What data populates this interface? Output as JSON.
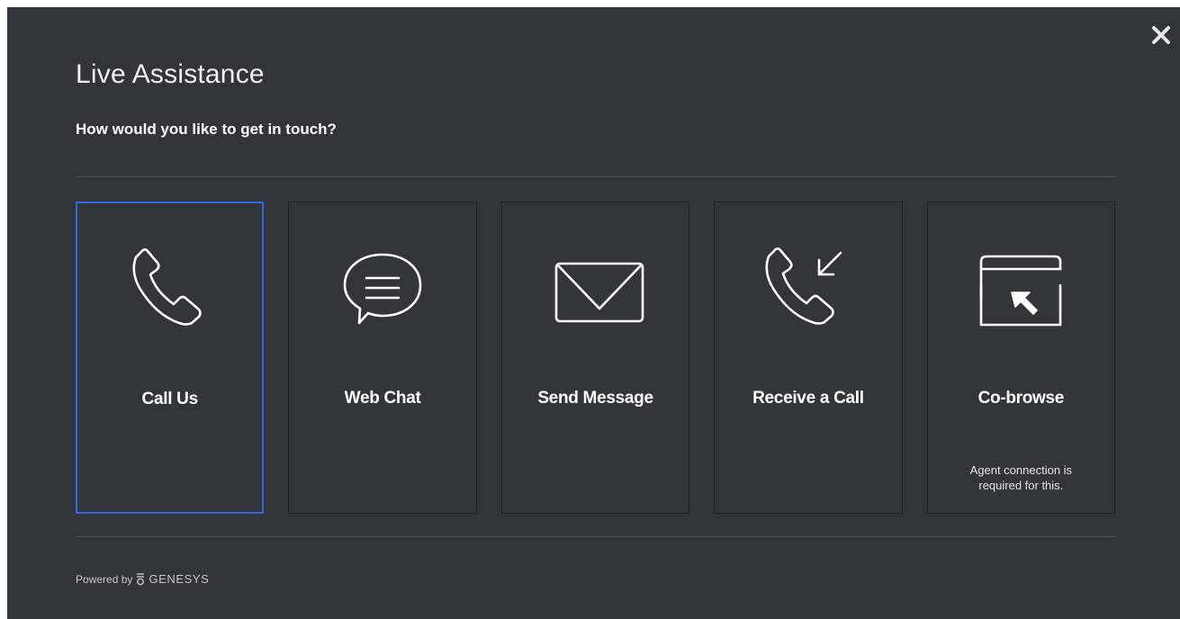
{
  "dialog": {
    "title": "Live Assistance",
    "subtitle": "How would you like to get in touch?",
    "close_icon": "close-icon"
  },
  "options": [
    {
      "label": "Call Us",
      "icon": "phone-icon",
      "selected": true,
      "note": ""
    },
    {
      "label": "Web Chat",
      "icon": "chat-bubble-icon",
      "selected": false,
      "note": ""
    },
    {
      "label": "Send Message",
      "icon": "envelope-icon",
      "selected": false,
      "note": ""
    },
    {
      "label": "Receive a Call",
      "icon": "incoming-call-icon",
      "selected": false,
      "note": ""
    },
    {
      "label": "Co-browse",
      "icon": "co-browse-icon",
      "selected": false,
      "note": "Agent connection is required for this."
    }
  ],
  "footer": {
    "powered_by": "Powered by",
    "brand": "GENESYS",
    "logo_icon": "genesys-logo-icon"
  },
  "colors": {
    "background": "#32363a",
    "selected_border": "#2e6ad8",
    "text": "#ffffff"
  }
}
